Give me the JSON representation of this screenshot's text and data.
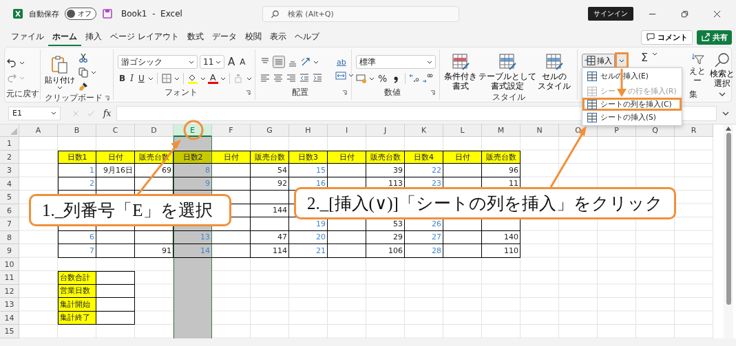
{
  "window": {
    "autosave_label": "自動保存",
    "autosave": {
      "label": "オフ",
      "on": false
    },
    "title": "Book1  -  Excel",
    "search_placeholder": "検索 (Alt+Q)",
    "sign_in": "サインイン"
  },
  "tabs": [
    {
      "label": "ファイル",
      "selected": false
    },
    {
      "label": "ホーム",
      "selected": true
    },
    {
      "label": "挿入",
      "selected": false
    },
    {
      "label": "ページ レイアウト",
      "selected": false
    },
    {
      "label": "数式",
      "selected": false
    },
    {
      "label": "データ",
      "selected": false
    },
    {
      "label": "校閲",
      "selected": false
    },
    {
      "label": "表示",
      "selected": false
    },
    {
      "label": "ヘルプ",
      "selected": false
    }
  ],
  "comment": "コメント",
  "share": "共有",
  "ribbon": {
    "undo": {
      "label": "元に戻す"
    },
    "clipboard": {
      "label": "クリップボード",
      "paste": "貼り付け"
    },
    "font": {
      "label": "フォント",
      "name": "游ゴシック",
      "size": "11",
      "grow": "A",
      "shrink": "A",
      "bold": "B",
      "italic": "I",
      "underline": "U",
      "font_color_letter": "A"
    },
    "alignment": {
      "label": "配置",
      "wrap": "ab"
    },
    "number": {
      "label": "数値",
      "format": "標準",
      "percent": "%"
    },
    "styles": {
      "label": "スタイル",
      "buttons": [
        [
          "条件付き",
          "書式"
        ],
        [
          "テーブルとして",
          "書式設定"
        ],
        [
          "セルの",
          "スタイル"
        ]
      ]
    },
    "cells": {
      "insert": "挿入",
      "dropdown_highlighted": true
    },
    "editing": {
      "sum": "Σ",
      "sort_lines": [
        "えと",
        "ー"
      ],
      "find": [
        "検索と",
        "選択"
      ],
      "label": "集"
    }
  },
  "insert_menu": {
    "items": [
      {
        "label": "セルの挿入(E)",
        "disabled": false,
        "highlighted": false
      },
      {
        "label_parts": [
          "シー",
          "の行を挿入(R)"
        ],
        "disabled": true,
        "highlighted": false
      },
      {
        "label": "シートの列を挿入(C)",
        "disabled": false,
        "highlighted": true
      },
      {
        "label": "シートの挿入(S)",
        "disabled": false,
        "highlighted": false
      }
    ]
  },
  "formula_bar": {
    "name_box": "E1",
    "fx": "fx"
  },
  "sheet": {
    "columns": [
      {
        "label": "A",
        "selected": false
      },
      {
        "label": "B",
        "selected": false
      },
      {
        "label": "C",
        "selected": false
      },
      {
        "label": "D",
        "selected": false
      },
      {
        "label": "E",
        "selected": true
      },
      {
        "label": "F",
        "selected": false
      },
      {
        "label": "G",
        "selected": false
      },
      {
        "label": "H",
        "selected": false
      },
      {
        "label": "I",
        "selected": false
      },
      {
        "label": "J",
        "selected": false
      },
      {
        "label": "K",
        "selected": false
      },
      {
        "label": "L",
        "selected": false
      },
      {
        "label": "M",
        "selected": false
      },
      {
        "label": "N",
        "selected": false
      },
      {
        "label": "O",
        "selected": false
      },
      {
        "label": "P",
        "selected": false
      },
      {
        "label": "Q",
        "selected": false
      },
      {
        "label": "R",
        "selected": false
      }
    ],
    "rows": [
      {
        "label": "1"
      },
      {
        "label": "2",
        "cells": [
          null,
          {
            "text": "日数1",
            "kind": "header"
          },
          {
            "text": "日付",
            "kind": "header"
          },
          {
            "text": "販売台数",
            "kind": "header"
          },
          {
            "text": "日数2",
            "kind": "header"
          },
          {
            "text": "日付",
            "kind": "header"
          },
          {
            "text": "販売台数",
            "kind": "header"
          },
          {
            "text": "日数3",
            "kind": "header"
          },
          {
            "text": "日付",
            "kind": "header"
          },
          {
            "text": "販売台数",
            "kind": "header"
          },
          {
            "text": "日数4",
            "kind": "header"
          },
          {
            "text": "日付",
            "kind": "header"
          },
          {
            "text": "販売台数",
            "kind": "header"
          }
        ]
      },
      {
        "label": "3",
        "cells": [
          null,
          {
            "text": "1",
            "kind": "day"
          },
          {
            "text": "9月16日",
            "kind": "value"
          },
          {
            "text": "69",
            "kind": "value"
          },
          {
            "text": "8",
            "kind": "day"
          },
          {
            "kind": "value"
          },
          {
            "text": "54",
            "kind": "value"
          },
          {
            "text": "15",
            "kind": "day"
          },
          {
            "kind": "value"
          },
          {
            "text": "39",
            "kind": "value"
          },
          {
            "text": "22",
            "kind": "day"
          },
          {
            "kind": "value"
          },
          {
            "text": "96",
            "kind": "value"
          }
        ]
      },
      {
        "label": "4",
        "cells": [
          null,
          {
            "text": "2",
            "kind": "day"
          },
          {
            "kind": "value"
          },
          {
            "kind": "value"
          },
          {
            "text": "9",
            "kind": "day"
          },
          {
            "kind": "value"
          },
          {
            "text": "92",
            "kind": "value"
          },
          {
            "text": "16",
            "kind": "day"
          },
          {
            "kind": "value"
          },
          {
            "text": "113",
            "kind": "value"
          },
          {
            "text": "23",
            "kind": "day"
          },
          {
            "kind": "value"
          },
          {
            "text": "11",
            "kind": "value"
          }
        ]
      },
      {
        "label": "5",
        "cells": [
          null,
          {
            "kind": "day"
          },
          {
            "kind": "value"
          },
          {
            "kind": "value"
          },
          {
            "kind": "day"
          },
          {
            "kind": "value"
          },
          {
            "kind": "value"
          },
          {
            "kind": "day"
          },
          null,
          null,
          null,
          null,
          {
            "kind": "value"
          }
        ]
      },
      {
        "label": "6",
        "cells": [
          null,
          {
            "kind": "day"
          },
          {
            "kind": "value"
          },
          {
            "kind": "value"
          },
          {
            "kind": "day"
          },
          {
            "kind": "value"
          },
          {
            "text": "144",
            "kind": "value"
          },
          {
            "kind": "day"
          },
          {
            "kind": "value"
          },
          {
            "kind": "value"
          },
          {
            "kind": "day"
          },
          {
            "kind": "value"
          },
          {
            "kind": "value"
          }
        ]
      },
      {
        "label": "7",
        "cells": [
          null,
          {
            "kind": "day"
          },
          {
            "kind": "value"
          },
          {
            "kind": "value"
          },
          {
            "kind": "day"
          },
          {
            "kind": "value"
          },
          {
            "kind": "value"
          },
          {
            "text": "19",
            "kind": "day"
          },
          {
            "kind": "value"
          },
          {
            "text": "53",
            "kind": "value"
          },
          {
            "text": "26",
            "kind": "day"
          },
          {
            "kind": "value"
          },
          {
            "kind": "value"
          }
        ]
      },
      {
        "label": "8",
        "cells": [
          null,
          {
            "text": "6",
            "kind": "day"
          },
          {
            "kind": "value"
          },
          {
            "kind": "value"
          },
          {
            "text": "13",
            "kind": "day"
          },
          {
            "kind": "value"
          },
          {
            "text": "47",
            "kind": "value"
          },
          {
            "text": "20",
            "kind": "day"
          },
          {
            "kind": "value"
          },
          {
            "text": "29",
            "kind": "value"
          },
          {
            "text": "27",
            "kind": "day"
          },
          {
            "kind": "value"
          },
          {
            "text": "140",
            "kind": "value"
          }
        ]
      },
      {
        "label": "9",
        "cells": [
          null,
          {
            "text": "7",
            "kind": "day"
          },
          {
            "kind": "value"
          },
          {
            "text": "91",
            "kind": "value"
          },
          {
            "text": "14",
            "kind": "day"
          },
          {
            "kind": "value"
          },
          {
            "text": "114",
            "kind": "value"
          },
          {
            "text": "21",
            "kind": "day"
          },
          {
            "kind": "value"
          },
          {
            "text": "106",
            "kind": "value"
          },
          {
            "text": "28",
            "kind": "day"
          },
          {
            "kind": "value"
          },
          {
            "text": "110",
            "kind": "value"
          }
        ]
      },
      {
        "label": "10"
      },
      {
        "label": "11",
        "cells": [
          null,
          {
            "text": "台数合計",
            "kind": "label"
          },
          {
            "kind": "value"
          }
        ]
      },
      {
        "label": "12",
        "cells": [
          null,
          {
            "text": "営業日数",
            "kind": "label"
          },
          {
            "kind": "value"
          }
        ]
      },
      {
        "label": "13",
        "cells": [
          null,
          {
            "text": "集計開始",
            "kind": "label"
          },
          {
            "kind": "value"
          }
        ]
      },
      {
        "label": "14",
        "cells": [
          null,
          {
            "text": "集計終了",
            "kind": "label"
          },
          {
            "kind": "value"
          }
        ]
      },
      {
        "label": "15"
      }
    ]
  },
  "annotations": [
    {
      "text": "1._列番号「E」を選択"
    },
    {
      "text": "2._[挿入(∨)]「シートの列を挿入」をクリック"
    }
  ]
}
